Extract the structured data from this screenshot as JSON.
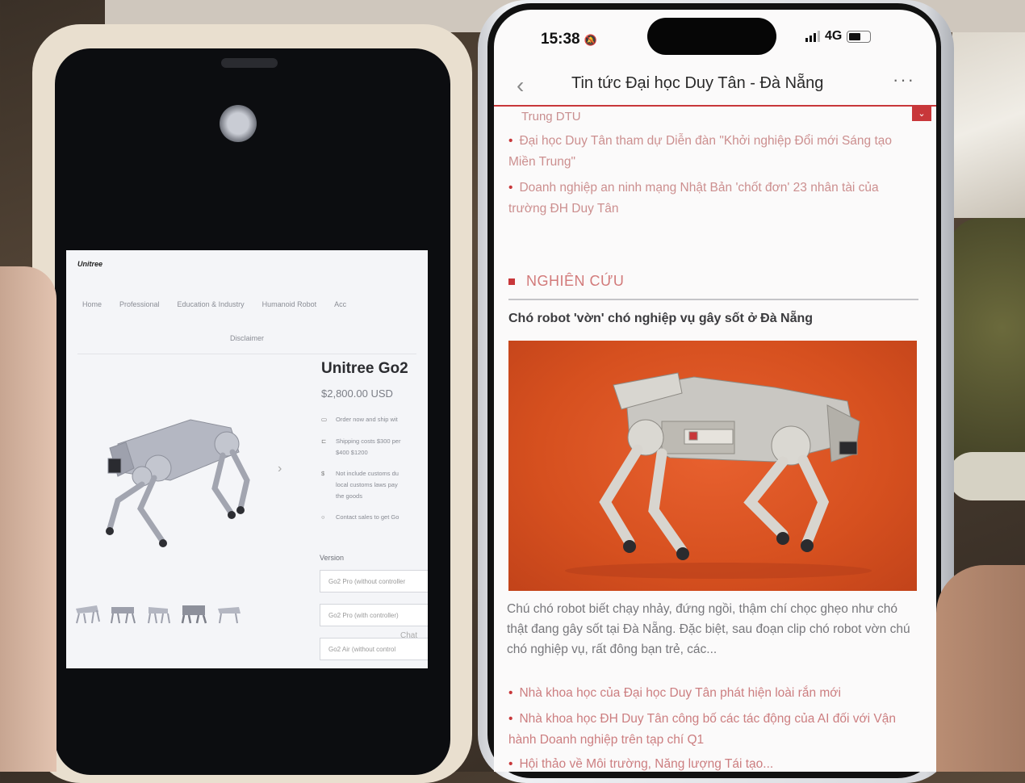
{
  "left_phone": {
    "brand": "Unitree",
    "nav": [
      "Home",
      "Professional",
      "Education & Industry",
      "Humanoid Robot",
      "Acc"
    ],
    "disclaimer": "Disclaimer",
    "product_title": "Unitree Go2",
    "price": "$2,800.00 USD",
    "features": [
      "Order now and ship wit",
      "Shipping costs $300 per",
      "$400 $1200",
      "Not include customs du",
      "local customs laws pay",
      "the goods",
      "Contact sales to get Go"
    ],
    "version_label": "Version",
    "version_options": [
      "Go2 Pro (without controller",
      "Go2 Pro (with controller)",
      "Go2 Air (without control"
    ],
    "chat_hint": "Chat"
  },
  "right_phone": {
    "status": {
      "time": "15:38",
      "network": "4G"
    },
    "app_title": "Tin tức Đại học Duy Tân - Đà Nẵng",
    "trailing_text": "Trung DTU",
    "related_links": [
      "Đại học Duy Tân tham dự Diễn đàn \"Khởi nghiệp Đổi mới Sáng tạo Miền Trung\"",
      "Doanh nghiệp an ninh mạng Nhật Bản 'chốt đơn' 23 nhân tài của trường ĐH Duy Tân"
    ],
    "section_title": "NGHIÊN CỨU",
    "article_title": "Chó robot 'vờn' chó nghiệp vụ gây sốt ở Đà Nẵng",
    "article_desc": "Chú chó robot biết chạy nhảy, đứng ngồi, thậm chí chọc ghẹo như chó thật đang gây sốt tại Đà Nẵng. Đặc biệt, sau đoạn clip chó robot vờn chú chó nghiệp vụ, rất đông bạn trẻ, các...",
    "more_links": [
      "Nhà khoa học của Đại học Duy Tân phát hiện loài rắn mới",
      "Nhà khoa học ĐH Duy Tân công bố các tác động của AI đối với Vận hành Doanh nghiệp trên tạp chí Q1",
      "Hội thảo về Môi trường, Năng lượng Tái tạo..."
    ]
  },
  "colors": {
    "accent_red": "#c8373a",
    "robot_grey": "#a9abb3"
  }
}
